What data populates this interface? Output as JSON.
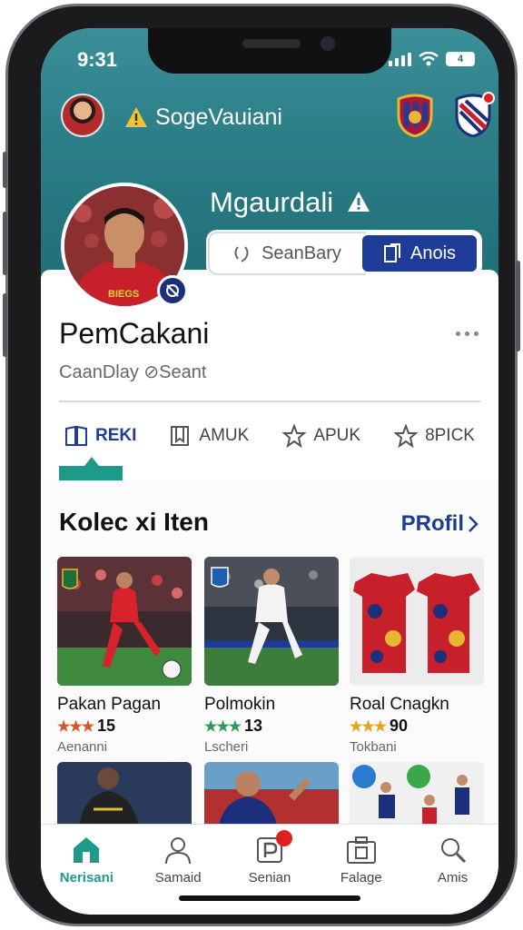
{
  "status": {
    "time": "9:31",
    "battery": "4"
  },
  "header": {
    "title": "SogeVauiani"
  },
  "profile": {
    "name_top": "Mgaurdali",
    "name": "PemCakani",
    "subtitle": "CaanDlay ⊘Seant",
    "buttons": {
      "secondary": "SeanBary",
      "primary": "Anois"
    },
    "jersey_text": "BIEGS"
  },
  "tabs": [
    {
      "label": "REKI",
      "icon": "book-icon",
      "active": true
    },
    {
      "label": "AMUK",
      "icon": "bookmark-icon",
      "active": false
    },
    {
      "label": "APUK",
      "icon": "star-icon",
      "active": false
    },
    {
      "label": "8PICK",
      "icon": "star-icon",
      "active": false
    }
  ],
  "section": {
    "title": "Kolec xi Iten",
    "link": "PRofil"
  },
  "items": [
    {
      "title": "Pakan Pagan",
      "stars": "★★★",
      "star_color": "#d9552b",
      "rating": "15",
      "sub": "Aenanni"
    },
    {
      "title": "Polmokin",
      "stars": "★★★",
      "star_color": "#2f9a5a",
      "rating": "13",
      "sub": "Lscheri"
    },
    {
      "title": "Roal Cnagkn",
      "stars": "★★★",
      "star_color": "#e8a317",
      "rating": "90",
      "sub": "Tokbani"
    }
  ],
  "nav": [
    {
      "label": "Nerisani",
      "icon": "home-icon",
      "active": true
    },
    {
      "label": "Samaid",
      "icon": "user-icon",
      "active": false
    },
    {
      "label": "Senian",
      "icon": "parking-icon",
      "active": false,
      "badge": ""
    },
    {
      "label": "Falage",
      "icon": "camera-icon",
      "active": false
    },
    {
      "label": "Amis",
      "icon": "search-icon",
      "active": false
    }
  ],
  "colors": {
    "teal": "#2b7d86",
    "primary": "#1f3b98",
    "accent": "#1d9a8a"
  }
}
